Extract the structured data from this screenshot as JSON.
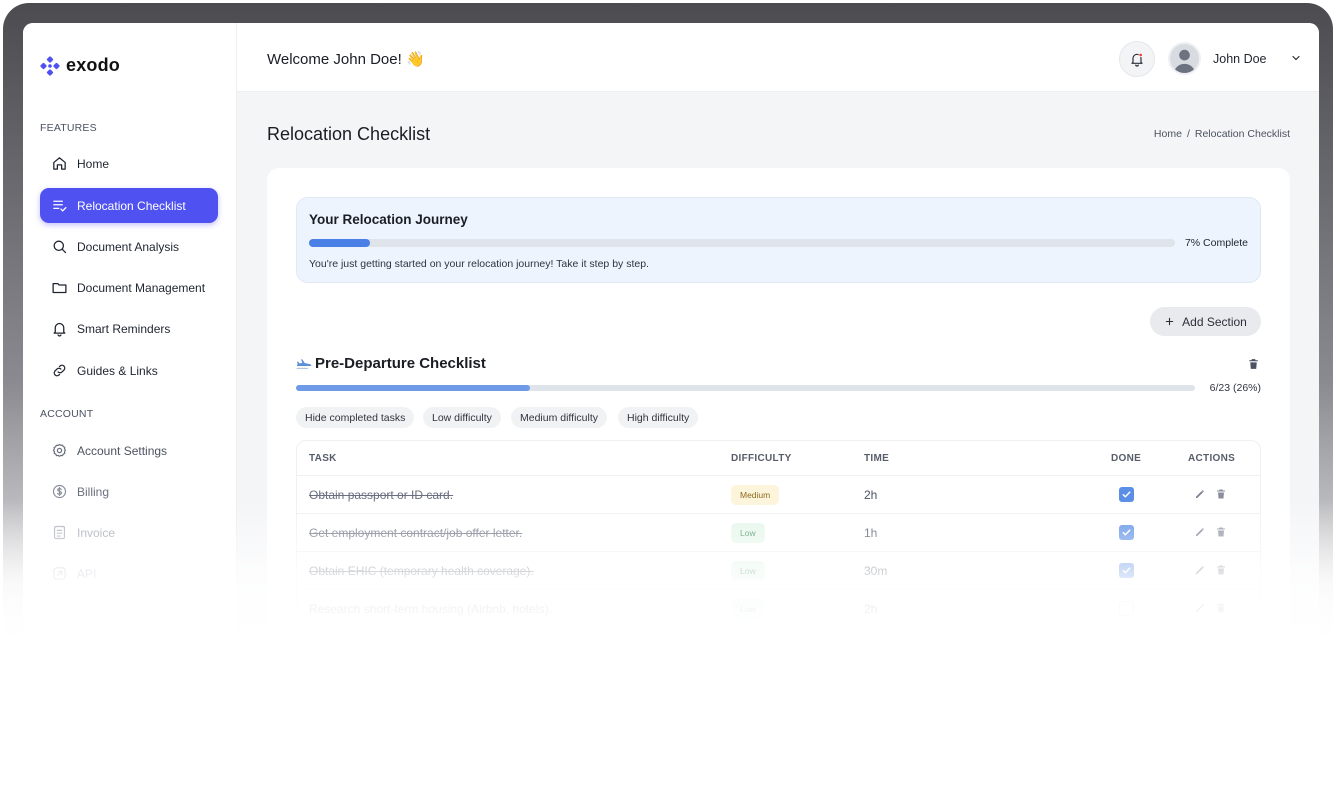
{
  "brand": {
    "name": "exodo",
    "accent": "#4f51f0"
  },
  "sidebar": {
    "features_label": "FEATURES",
    "account_label": "ACCOUNT",
    "features": [
      {
        "label": "Home",
        "icon": "home-icon"
      },
      {
        "label": "Relocation Checklist",
        "icon": "checklist-icon",
        "active": true
      },
      {
        "label": "Document Analysis",
        "icon": "search-icon"
      },
      {
        "label": "Document Management",
        "icon": "folder-icon"
      },
      {
        "label": "Smart Reminders",
        "icon": "bell-icon"
      },
      {
        "label": "Guides & Links",
        "icon": "link-icon"
      }
    ],
    "account": [
      {
        "label": "Account Settings",
        "icon": "gear-icon"
      },
      {
        "label": "Billing",
        "icon": "dollar-icon"
      },
      {
        "label": "Invoice",
        "icon": "invoice-icon"
      },
      {
        "label": "API",
        "icon": "api-icon"
      }
    ]
  },
  "header": {
    "welcome": "Welcome John Doe! 👋",
    "user_name": "John Doe"
  },
  "page": {
    "title": "Relocation Checklist",
    "breadcrumb": [
      "Home",
      "Relocation Checklist"
    ]
  },
  "journey": {
    "title": "Your Relocation Journey",
    "progress_percent": 7,
    "progress_label": "7% Complete",
    "message": "You're just getting started on your relocation journey! Take it step by step."
  },
  "add_section_label": "Add Section",
  "checklist": {
    "icon": "airplane-icon",
    "title": "Pre-Departure Checklist",
    "progress_fraction": 0.26,
    "progress_label": "6/23 (26%)",
    "filters": [
      "Hide completed tasks",
      "Low difficulty",
      "Medium difficulty",
      "High difficulty"
    ],
    "columns": [
      "TASK",
      "DIFFICULTY",
      "TIME",
      "DONE",
      "ACTIONS"
    ],
    "rows": [
      {
        "task": "Obtain passport or ID card.",
        "difficulty": "Medium",
        "time": "2h",
        "done": true
      },
      {
        "task": "Get employment contract/job offer letter.",
        "difficulty": "Low",
        "time": "1h",
        "done": true
      },
      {
        "task": "Obtain EHIC (temporary health coverage).",
        "difficulty": "Low",
        "time": "30m",
        "done": true
      },
      {
        "task": "Research short-term housing (Airbnb, hotels).",
        "difficulty": "Low",
        "time": "2h",
        "done": false
      }
    ]
  }
}
